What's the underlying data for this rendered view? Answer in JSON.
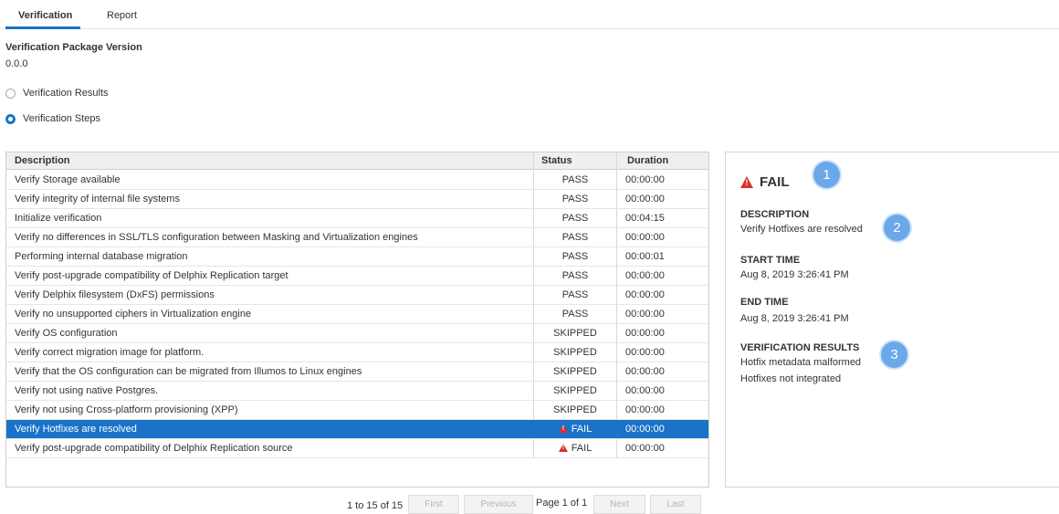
{
  "tabs": [
    {
      "label": "Verification",
      "active": true
    },
    {
      "label": "Report",
      "active": false
    }
  ],
  "package": {
    "title": "Verification Package Version",
    "version": "0.0.0"
  },
  "view_options": [
    {
      "label": "Verification Results",
      "selected": false
    },
    {
      "label": "Verification Steps",
      "selected": true
    }
  ],
  "table": {
    "headers": {
      "description": "Description",
      "status": "Status",
      "duration": "Duration"
    },
    "rows": [
      {
        "description": "Verify Storage available",
        "status": "PASS",
        "duration": "00:00:00"
      },
      {
        "description": "Verify integrity of internal file systems",
        "status": "PASS",
        "duration": "00:00:00"
      },
      {
        "description": "Initialize verification",
        "status": "PASS",
        "duration": "00:04:15"
      },
      {
        "description": "Verify no differences in SSL/TLS configuration between Masking and Virtualization engines",
        "status": "PASS",
        "duration": "00:00:00"
      },
      {
        "description": "Performing internal database migration",
        "status": "PASS",
        "duration": "00:00:01"
      },
      {
        "description": "Verify post-upgrade compatibility of Delphix Replication target",
        "status": "PASS",
        "duration": "00:00:00"
      },
      {
        "description": "Verify Delphix filesystem (DxFS) permissions",
        "status": "PASS",
        "duration": "00:00:00"
      },
      {
        "description": "Verify no unsupported ciphers in Virtualization engine",
        "status": "PASS",
        "duration": "00:00:00"
      },
      {
        "description": "Verify OS configuration",
        "status": "SKIPPED",
        "duration": "00:00:00"
      },
      {
        "description": "Verify correct migration image for platform.",
        "status": "SKIPPED",
        "duration": "00:00:00"
      },
      {
        "description": "Verify that the OS configuration can be migrated from Illumos to Linux engines",
        "status": "SKIPPED",
        "duration": "00:00:00"
      },
      {
        "description": "Verify not using native Postgres.",
        "status": "SKIPPED",
        "duration": "00:00:00"
      },
      {
        "description": "Verify not using Cross-platform provisioning (XPP)",
        "status": "SKIPPED",
        "duration": "00:00:00"
      },
      {
        "description": "Verify Hotfixes are resolved",
        "status": "FAIL",
        "duration": "00:00:00",
        "selected": true,
        "icon": "warning-icon"
      },
      {
        "description": "Verify post-upgrade compatibility of Delphix Replication source",
        "status": "FAIL",
        "duration": "00:00:00",
        "icon": "warning-icon"
      }
    ]
  },
  "pager": {
    "count": "1 to 15 of 15",
    "first": "First",
    "previous": "Previous",
    "page_info": "Page 1 of 1",
    "next": "Next",
    "last": "Last"
  },
  "detail": {
    "status": "FAIL",
    "description_label": "DESCRIPTION",
    "description": "Verify Hotfixes are resolved",
    "start_label": "START TIME",
    "start_time": "Aug 8, 2019 3:26:41 PM",
    "end_label": "END TIME",
    "end_time": "Aug 8, 2019 3:26:41 PM",
    "results_label": "VERIFICATION RESULTS",
    "results": [
      "Hotfix metadata malformed",
      "Hotfixes not integrated"
    ],
    "callouts": [
      "1",
      "2",
      "3"
    ]
  },
  "colors": {
    "accent": "#1a73c9",
    "fail": "#d93025",
    "callout": "#6aa8ea"
  }
}
